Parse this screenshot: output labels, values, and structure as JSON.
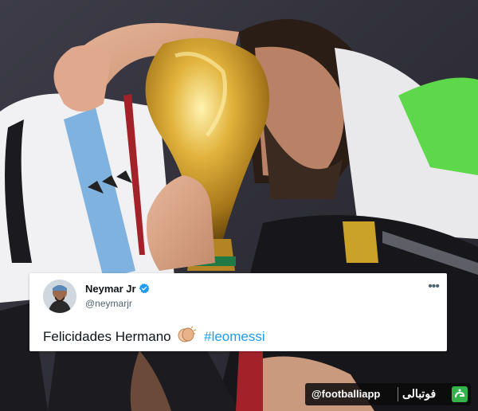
{
  "tweet": {
    "author_name": "Neymar Jr",
    "handle": "@neymarjr",
    "text": "Felicidades Hermano",
    "hashtag": "#leomessi"
  },
  "watermark": {
    "handle": "@footballiapp",
    "brand_name": "فوتبالی",
    "logo_color": "#36b24a"
  },
  "colors": {
    "link": "#1d9bf0",
    "verified": "#1d9bf0",
    "trophy_gold": "#c9a227"
  },
  "icons": {
    "verified": "verified-badge-icon",
    "more": "more-options-icon",
    "clap": "clapping-hands-icon",
    "logo": "footballi-logo-icon"
  }
}
